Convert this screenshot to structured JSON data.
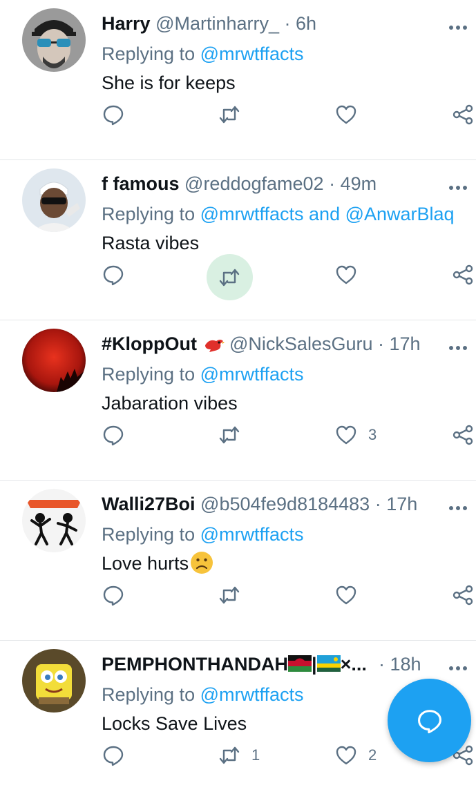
{
  "tweets": [
    {
      "name": "Harry",
      "handle": "@Martinharry_",
      "time": "· 6h",
      "reply_prefix": "Replying to",
      "reply_to": "@mrwtffacts",
      "text": "She is for keeps",
      "reply_count": "",
      "retweet_count": "",
      "like_count": ""
    },
    {
      "name": "f famous",
      "handle": "@reddogfame02",
      "time": "· 49m",
      "reply_prefix": "Replying to",
      "reply_to": "@mrwtffacts and @AnwarBlaq",
      "text": "Rasta vibes",
      "reply_count": "",
      "retweet_count": "",
      "like_count": ""
    },
    {
      "name": "#KloppOut",
      "handle": "@NickSalesGuru",
      "time": "· 17h",
      "reply_prefix": "Replying to",
      "reply_to": "@mrwtffacts",
      "text": "Jabaration vibes",
      "reply_count": "",
      "retweet_count": "",
      "like_count": "3"
    },
    {
      "name": "Walli27Boi",
      "handle": "@b504fe9d8184483",
      "time": "· 17h",
      "reply_prefix": "Replying to",
      "reply_to": "@mrwtffacts",
      "text": "Love hurts",
      "reply_count": "",
      "retweet_count": "",
      "like_count": ""
    },
    {
      "name": "PEMPHONTHANDAH",
      "name_suffix": "|",
      "name_trunc": "×...",
      "handle": "",
      "time": "· 18h",
      "reply_prefix": "Replying to",
      "reply_to": "@mrwtffacts",
      "text": "Locks Save Lives",
      "reply_count": "",
      "retweet_count": "1",
      "like_count": "2"
    }
  ],
  "colors": {
    "accent": "#1da1f2",
    "secondary_text": "#5b7083",
    "retweet_highlight": "#d9f0e2"
  },
  "icons": {
    "reply": "reply-icon",
    "retweet": "retweet-icon",
    "like": "heart-icon",
    "share": "share-icon",
    "more": "more-icon",
    "compose": "compose-reply-icon"
  }
}
